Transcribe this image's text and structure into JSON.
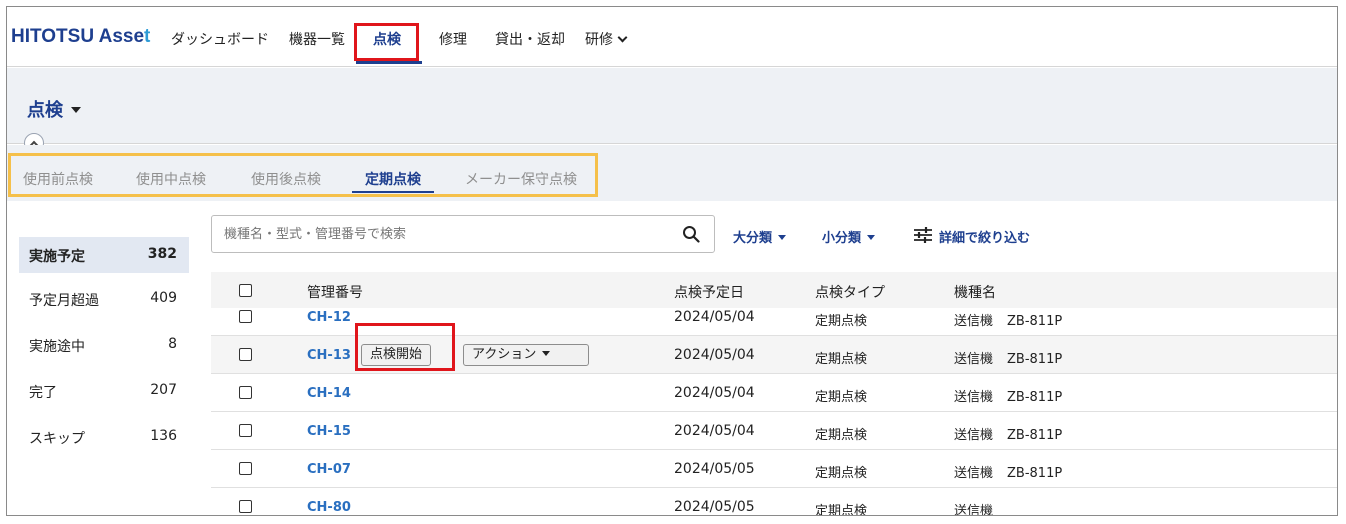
{
  "app": {
    "logo_main": "HITOTSU Asse",
    "logo_accent": "t"
  },
  "nav": {
    "items": [
      {
        "label": "ダッシュボード"
      },
      {
        "label": "機器一覧"
      },
      {
        "label": "点検"
      },
      {
        "label": "修理"
      },
      {
        "label": "貸出・返却"
      },
      {
        "label": "研修"
      }
    ],
    "active": "点検"
  },
  "page": {
    "title": "点検"
  },
  "tabs": {
    "items": [
      {
        "label": "使用前点検"
      },
      {
        "label": "使用中点検"
      },
      {
        "label": "使用後点検"
      },
      {
        "label": "定期点検"
      },
      {
        "label": "メーカー保守点検"
      }
    ],
    "active": "定期点検"
  },
  "status": {
    "items": [
      {
        "label": "実施予定",
        "count": "382"
      },
      {
        "label": "予定月超過",
        "count": "409"
      },
      {
        "label": "実施途中",
        "count": "8"
      },
      {
        "label": "完了",
        "count": "207"
      },
      {
        "label": "スキップ",
        "count": "136"
      }
    ],
    "active": "実施予定"
  },
  "search": {
    "placeholder": "機種名・型式・管理番号で検索",
    "value": ""
  },
  "filters": {
    "major_category": "大分類",
    "minor_category": "小分類",
    "advanced": "詳細で絞り込む"
  },
  "table": {
    "headers": {
      "id": "管理番号",
      "date": "点検予定日",
      "type": "点検タイプ",
      "name": "機種名"
    },
    "rows": [
      {
        "id": "CH-12",
        "date": "2024/05/04",
        "type": "定期点検",
        "name": "送信機",
        "model": "ZB-811P"
      },
      {
        "id": "CH-13",
        "date": "2024/05/04",
        "type": "定期点検",
        "name": "送信機",
        "model": "ZB-811P"
      },
      {
        "id": "CH-14",
        "date": "2024/05/04",
        "type": "定期点検",
        "name": "送信機",
        "model": "ZB-811P"
      },
      {
        "id": "CH-15",
        "date": "2024/05/04",
        "type": "定期点検",
        "name": "送信機",
        "model": "ZB-811P"
      },
      {
        "id": "CH-07",
        "date": "2024/05/05",
        "type": "定期点検",
        "name": "送信機",
        "model": "ZB-811P"
      },
      {
        "id": "CH-80",
        "date": "2024/05/05",
        "type": "定期点検",
        "name": "送信機",
        "model": ""
      }
    ],
    "row_actions": {
      "start_label": "点検開始",
      "action_label": "アクション"
    }
  },
  "colors": {
    "brand": "#1e3f8f",
    "link": "#2a6fc0",
    "highlight_red": "#e0151b",
    "highlight_yellow": "#f5c04a"
  }
}
